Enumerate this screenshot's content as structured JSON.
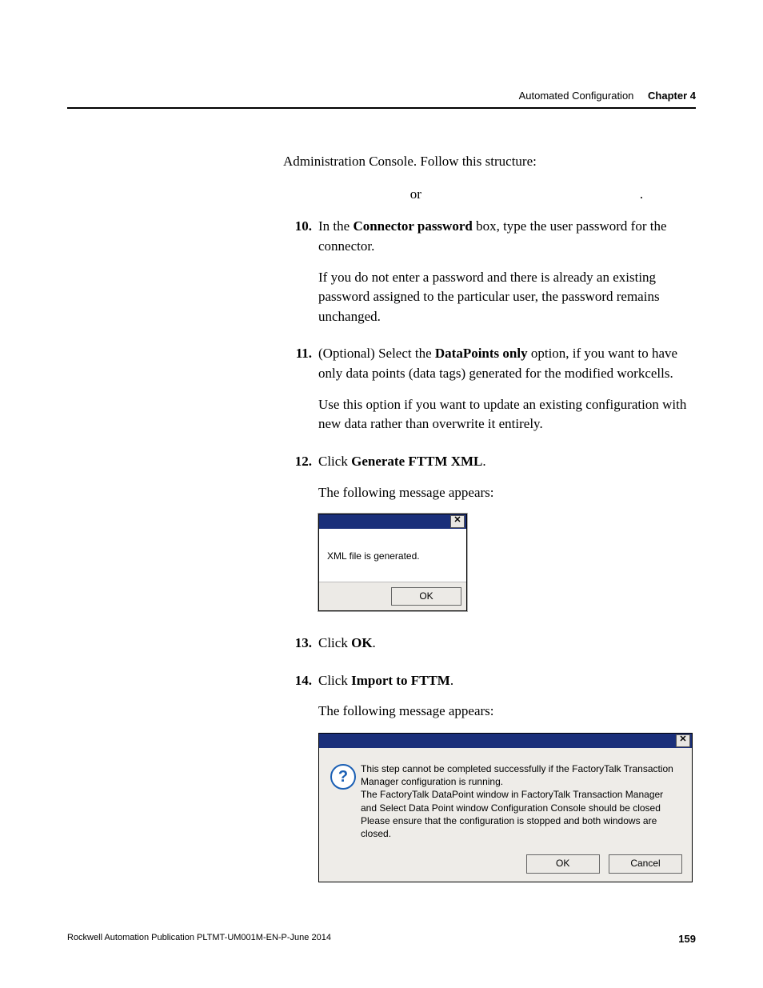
{
  "header": {
    "section": "Automated Configuration",
    "chapter": "Chapter 4"
  },
  "intro": {
    "line1": "Administration Console. Follow this structure:",
    "or": "or",
    "period": "."
  },
  "steps": [
    {
      "num": "10.",
      "para1_pre": "In the ",
      "para1_bold": "Connector password",
      "para1_post": " box, type the user password for the connector.",
      "para2": "If you do not enter a password and there is already an existing password assigned to the particular user, the password remains unchanged."
    },
    {
      "num": "11.",
      "para1_pre": "(Optional) Select the ",
      "para1_bold": "DataPoints only",
      "para1_post": " option, if you want to have only data points (data tags) generated for the modified workcells.",
      "para2": "Use this option if you want to update an existing configuration with new data rather than overwrite it entirely."
    },
    {
      "num": "12.",
      "para1_pre": "Click ",
      "para1_bold": "Generate FTTM XML",
      "para1_post": ".",
      "para2": "The following message appears:"
    },
    {
      "num": "13.",
      "para1_pre": "Click ",
      "para1_bold": "OK",
      "para1_post": "."
    },
    {
      "num": "14.",
      "para1_pre": "Click ",
      "para1_bold": "Import to FTTM",
      "para1_post": ".",
      "para2": "The following message appears:"
    }
  ],
  "dialog_small": {
    "message": "XML file is generated.",
    "ok": "OK",
    "close_glyph": "✕"
  },
  "dialog_large": {
    "icon_glyph": "?",
    "message": "This step cannot be completed successfully if the FactoryTalk Transaction Manager configuration is running.\nThe FactoryTalk DataPoint window in FactoryTalk Transaction Manager and Select Data Point window Configuration Console should be closed\nPlease ensure that the configuration is stopped and both windows are closed.",
    "ok": "OK",
    "cancel": "Cancel",
    "close_glyph": "✕"
  },
  "footer": {
    "pub": "Rockwell Automation Publication PLTMT-UM001M-EN-P-June 2014",
    "page": "159"
  }
}
